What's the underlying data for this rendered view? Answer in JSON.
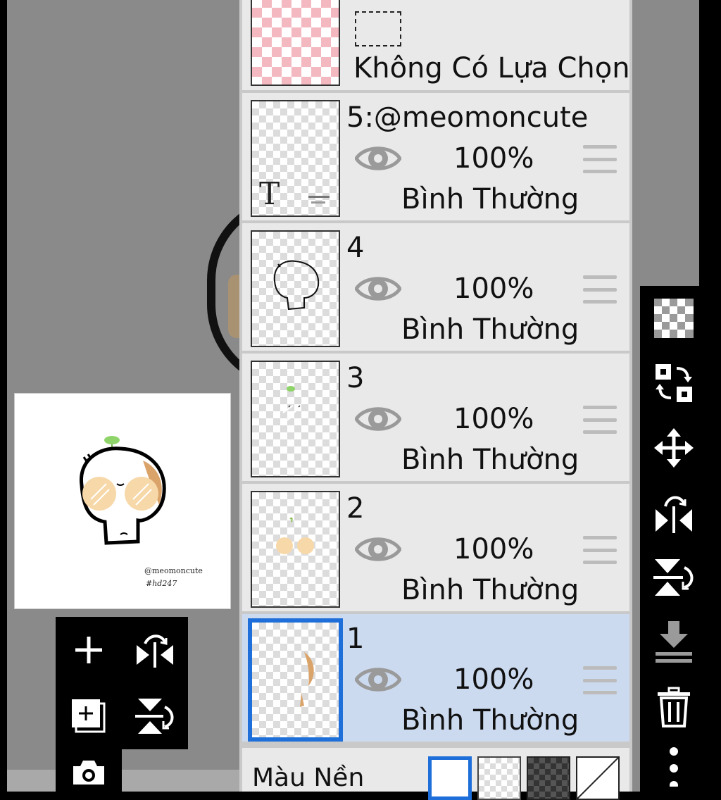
{
  "selection_layer": {
    "label": "Không Có Lựa Chọn"
  },
  "layers": [
    {
      "name": "5:@meomoncute",
      "opacity": "100%",
      "blend": "Bình Thường",
      "thumb_text": "T"
    },
    {
      "name": "4",
      "opacity": "100%",
      "blend": "Bình Thường"
    },
    {
      "name": "3",
      "opacity": "100%",
      "blend": "Bình Thường"
    },
    {
      "name": "2",
      "opacity": "100%",
      "blend": "Bình Thường"
    },
    {
      "name": "1",
      "opacity": "100%",
      "blend": "Bình Thường",
      "selected": true
    }
  ],
  "background": {
    "label": "Màu Nền",
    "options": [
      "white",
      "transparent",
      "dark-checker",
      "none"
    ],
    "selected": "white"
  },
  "navigator": {
    "watermark_line1": "@meomoncute",
    "watermark_line2": "#hd247"
  },
  "left_toolbox": {
    "icons": [
      "add-layer-icon",
      "flip-horizontal-icon",
      "add-copy-layer-icon",
      "flip-vertical-icon",
      "camera-icon"
    ]
  },
  "right_toolbar": {
    "icons": [
      "transparency-icon",
      "swap-layer-icon",
      "move-icon",
      "flip-horizontal-icon",
      "flip-vertical-icon",
      "merge-down-icon",
      "trash-icon",
      "more-icon"
    ]
  },
  "colors": {
    "selected_row": "#ccdaf0",
    "accent": "#1e6fd9",
    "row": "#e9e9e9",
    "panel_bg": "#c9c9c9",
    "canvas": "#8a8a8a"
  }
}
